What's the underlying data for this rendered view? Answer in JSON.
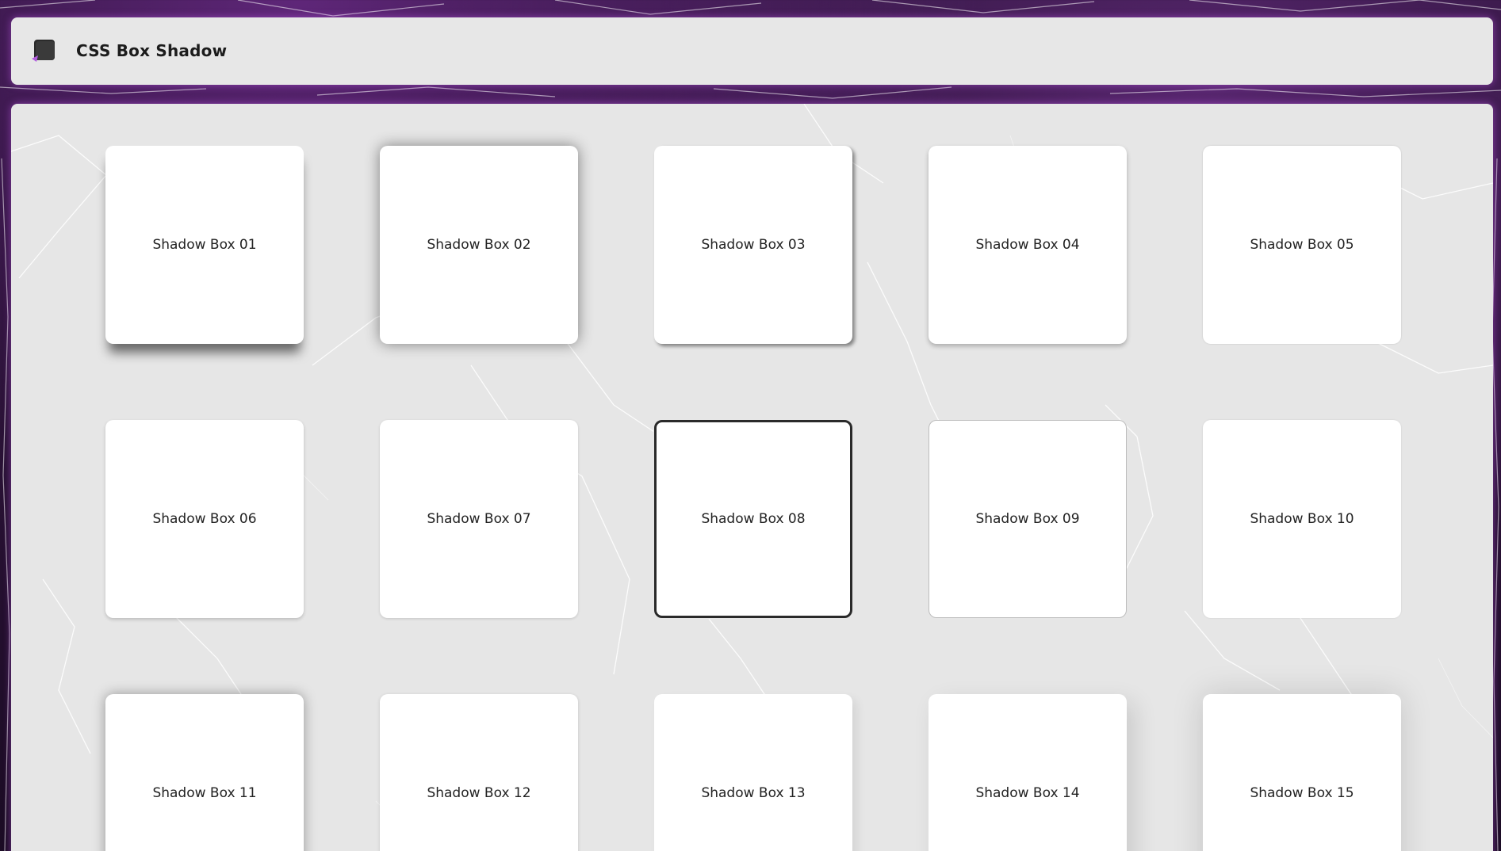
{
  "header": {
    "title": "CSS Box Shadow",
    "logo_icon": "box-shadow-logo-icon"
  },
  "boxes": [
    {
      "label": "Shadow Box 01"
    },
    {
      "label": "Shadow Box 02"
    },
    {
      "label": "Shadow Box 03"
    },
    {
      "label": "Shadow Box 04"
    },
    {
      "label": "Shadow Box 05"
    },
    {
      "label": "Shadow Box 06"
    },
    {
      "label": "Shadow Box 07"
    },
    {
      "label": "Shadow Box 08"
    },
    {
      "label": "Shadow Box 09"
    },
    {
      "label": "Shadow Box 10"
    },
    {
      "label": "Shadow Box 11"
    },
    {
      "label": "Shadow Box 12"
    },
    {
      "label": "Shadow Box 13"
    },
    {
      "label": "Shadow Box 14"
    },
    {
      "label": "Shadow Box 15"
    }
  ],
  "colors": {
    "page_background": "#1b0c24",
    "glow": "#be5ae6",
    "panel": "#e6e6e6",
    "box": "#ffffff",
    "text": "#222222"
  }
}
